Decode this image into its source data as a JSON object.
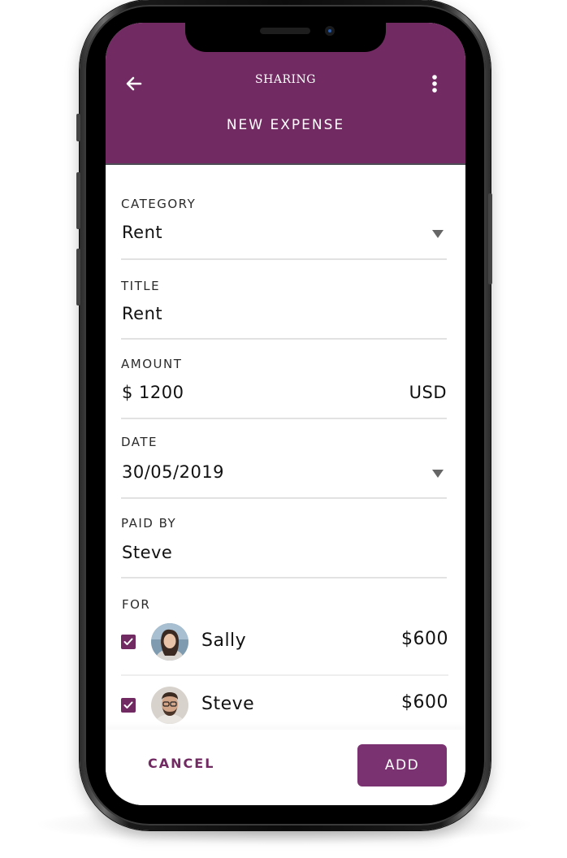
{
  "header": {
    "app_title": "SHARING",
    "page_title": "NEW EXPENSE",
    "back_icon": "arrow-left-icon",
    "menu_icon": "more-vertical-icon"
  },
  "form": {
    "category": {
      "label": "CATEGORY",
      "value": "Rent"
    },
    "title": {
      "label": "TITLE",
      "value": "Rent"
    },
    "amount": {
      "label": "AMOUNT",
      "value": "$ 1200",
      "currency": "USD"
    },
    "date": {
      "label": "DATE",
      "value": "30/05/2019"
    },
    "paid_by": {
      "label": "PAID BY",
      "value": "Steve"
    },
    "for": {
      "label": "FOR",
      "people": [
        {
          "name": "Sally",
          "amount": "$600",
          "checked": true
        },
        {
          "name": "Steve",
          "amount": "$600",
          "checked": true
        }
      ]
    }
  },
  "footer": {
    "cancel_label": "CANCEL",
    "add_label": "ADD"
  },
  "colors": {
    "primary": "#722a62",
    "button": "#7a3270",
    "divider": "#e2e2e2"
  }
}
